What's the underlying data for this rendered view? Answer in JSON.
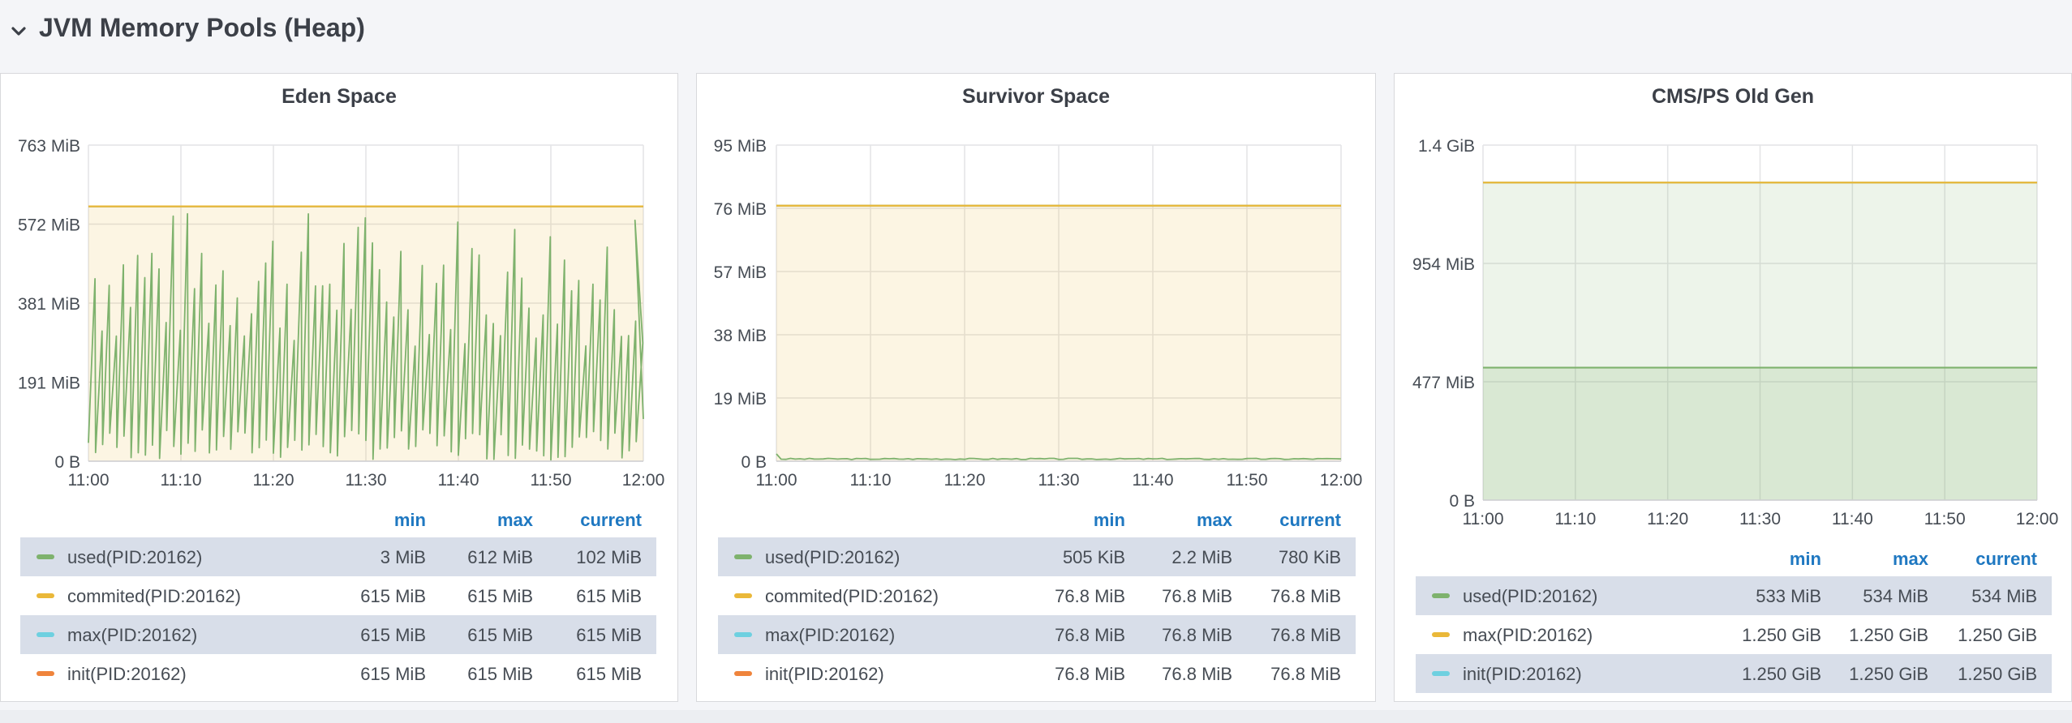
{
  "row": {
    "title": "JVM Memory Pools (Heap)",
    "icon": "chevron-down-icon"
  },
  "legend_columns": [
    "min",
    "max",
    "current"
  ],
  "panels": [
    {
      "title": "Eden Space",
      "chart_data": {
        "type": "line",
        "x_ticks": [
          "11:00",
          "11:10",
          "11:20",
          "11:30",
          "11:40",
          "11:50",
          "12:00"
        ],
        "y_ticks": [
          "0 B",
          "191 MiB",
          "381 MiB",
          "572 MiB",
          "763 MiB"
        ],
        "ylim": [
          0,
          763
        ],
        "y_unit": "MiB",
        "grid": true,
        "series": [
          {
            "name": "used(PID:20162)",
            "color": "#7eb26d",
            "shape": "sawtooth",
            "min": 3,
            "max": 612,
            "current": 102
          },
          {
            "name": "commited(PID:20162)",
            "color": "#eab839",
            "constant": 615
          },
          {
            "name": "max(PID:20162)",
            "color": "#6ed0e0",
            "constant": 615
          },
          {
            "name": "init(PID:20162)",
            "color": "#ef843c",
            "constant": 615
          }
        ]
      },
      "legend": [
        {
          "name": "used(PID:20162)",
          "color": "#7eb26d",
          "min": "3 MiB",
          "max": "612 MiB",
          "current": "102 MiB"
        },
        {
          "name": "commited(PID:20162)",
          "color": "#eab839",
          "min": "615 MiB",
          "max": "615 MiB",
          "current": "615 MiB"
        },
        {
          "name": "max(PID:20162)",
          "color": "#6ed0e0",
          "min": "615 MiB",
          "max": "615 MiB",
          "current": "615 MiB"
        },
        {
          "name": "init(PID:20162)",
          "color": "#ef843c",
          "min": "615 MiB",
          "max": "615 MiB",
          "current": "615 MiB"
        }
      ]
    },
    {
      "title": "Survivor Space",
      "chart_data": {
        "type": "line",
        "x_ticks": [
          "11:00",
          "11:10",
          "11:20",
          "11:30",
          "11:40",
          "11:50",
          "12:00"
        ],
        "y_ticks": [
          "0 B",
          "19 MiB",
          "38 MiB",
          "57 MiB",
          "76 MiB",
          "95 MiB"
        ],
        "ylim": [
          0,
          95
        ],
        "y_unit": "MiB",
        "grid": true,
        "series": [
          {
            "name": "used(PID:20162)",
            "color": "#7eb26d",
            "shape": "flat-noise",
            "min": 0.49,
            "max": 2.2,
            "current": 0.76
          },
          {
            "name": "commited(PID:20162)",
            "color": "#eab839",
            "constant": 76.8
          },
          {
            "name": "max(PID:20162)",
            "color": "#6ed0e0",
            "constant": 76.8
          },
          {
            "name": "init(PID:20162)",
            "color": "#ef843c",
            "constant": 76.8
          }
        ]
      },
      "legend": [
        {
          "name": "used(PID:20162)",
          "color": "#7eb26d",
          "min": "505 KiB",
          "max": "2.2 MiB",
          "current": "780 KiB"
        },
        {
          "name": "commited(PID:20162)",
          "color": "#eab839",
          "min": "76.8 MiB",
          "max": "76.8 MiB",
          "current": "76.8 MiB"
        },
        {
          "name": "max(PID:20162)",
          "color": "#6ed0e0",
          "min": "76.8 MiB",
          "max": "76.8 MiB",
          "current": "76.8 MiB"
        },
        {
          "name": "init(PID:20162)",
          "color": "#ef843c",
          "min": "76.8 MiB",
          "max": "76.8 MiB",
          "current": "76.8 MiB"
        }
      ]
    },
    {
      "title": "CMS/PS Old Gen",
      "chart_data": {
        "type": "line",
        "x_ticks": [
          "11:00",
          "11:10",
          "11:20",
          "11:30",
          "11:40",
          "11:50",
          "12:00"
        ],
        "y_ticks": [
          "0 B",
          "477 MiB",
          "954 MiB",
          "1.4 GiB"
        ],
        "ylim": [
          0,
          1431
        ],
        "y_unit": "MiB",
        "grid": true,
        "series": [
          {
            "name": "used(PID:20162)",
            "color": "#7eb26d",
            "constant": 534
          },
          {
            "name": "max(PID:20162)",
            "color": "#eab839",
            "constant": 1280
          },
          {
            "name": "init(PID:20162)",
            "color": "#6ed0e0",
            "constant": 1280
          }
        ]
      },
      "legend": [
        {
          "name": "used(PID:20162)",
          "color": "#7eb26d",
          "min": "533 MiB",
          "max": "534 MiB",
          "current": "534 MiB"
        },
        {
          "name": "max(PID:20162)",
          "color": "#eab839",
          "min": "1.250 GiB",
          "max": "1.250 GiB",
          "current": "1.250 GiB"
        },
        {
          "name": "init(PID:20162)",
          "color": "#6ed0e0",
          "min": "1.250 GiB",
          "max": "1.250 GiB",
          "current": "1.250 GiB"
        }
      ]
    }
  ]
}
